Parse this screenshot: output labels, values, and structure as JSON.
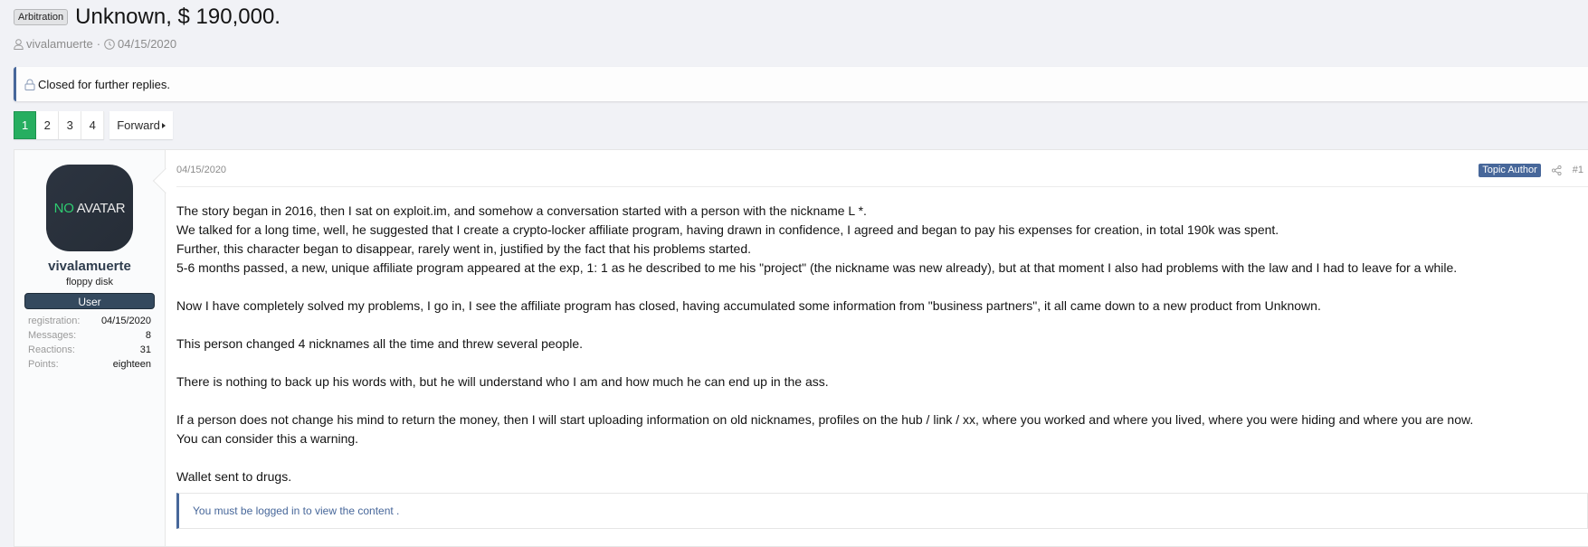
{
  "thread": {
    "prefix": "Arbitration",
    "title": "Unknown, $ 190,000.",
    "author": "vivalamuerte",
    "separator": "·",
    "date": "04/15/2020",
    "closed_notice": "Closed for further replies."
  },
  "pagination": {
    "pages": [
      "1",
      "2",
      "3",
      "4"
    ],
    "current": "1",
    "forward_label": "Forward"
  },
  "post": {
    "user": {
      "avatar_text_no": "NO",
      "avatar_text_avatar": "AVATAR",
      "username": "vivalamuerte",
      "user_title": "floppy disk",
      "banner": "User",
      "stats": [
        {
          "label": "registration:",
          "value": "04/15/2020"
        },
        {
          "label": "Messages:",
          "value": "8"
        },
        {
          "label": "Reactions:",
          "value": "31"
        },
        {
          "label": "Points:",
          "value": "eighteen"
        }
      ]
    },
    "date": "04/15/2020",
    "author_badge": "Topic Author",
    "post_number": "#1",
    "paragraphs": [
      "The story began in 2016, then I sat on exploit.im, and somehow a conversation started with a person with the nickname L *.",
      "We talked for a long time, well, he suggested that I create a crypto-locker affiliate program, having drawn in confidence, I agreed and began to pay his expenses for creation, in total 190k was spent.",
      "Further, this character began to disappear, rarely went in, justified by the fact that his problems started.",
      "5-6 months passed, a new, unique affiliate program appeared at the exp, 1: 1 as he described to me his \"project\" (the nickname was new already), but at that moment I also had problems with the law and I had to leave for a while.",
      "Now I have completely solved my problems, I go in, I see the affiliate program has closed, having accumulated some information from \"business partners\", it all came down to a new product from Unknown.",
      "This person changed 4 nicknames all the time and threw several people.",
      "There is nothing to back up his words with, but he will understand who I am and how much he can end up in the ass.",
      "If a person does not change his mind to return the money, then I will start uploading information on old nicknames, profiles on the hub / link / xx, where you worked and where you lived, where you were hiding and where you are now.",
      "You can consider this a warning.",
      "Wallet sent to drugs."
    ],
    "login_notice": "You must be logged in to view the content ."
  },
  "colors": {
    "accent": "#47679a",
    "active_page": "#27ae60",
    "avatar_no": "#2ecc71",
    "banner": "#34495e"
  }
}
